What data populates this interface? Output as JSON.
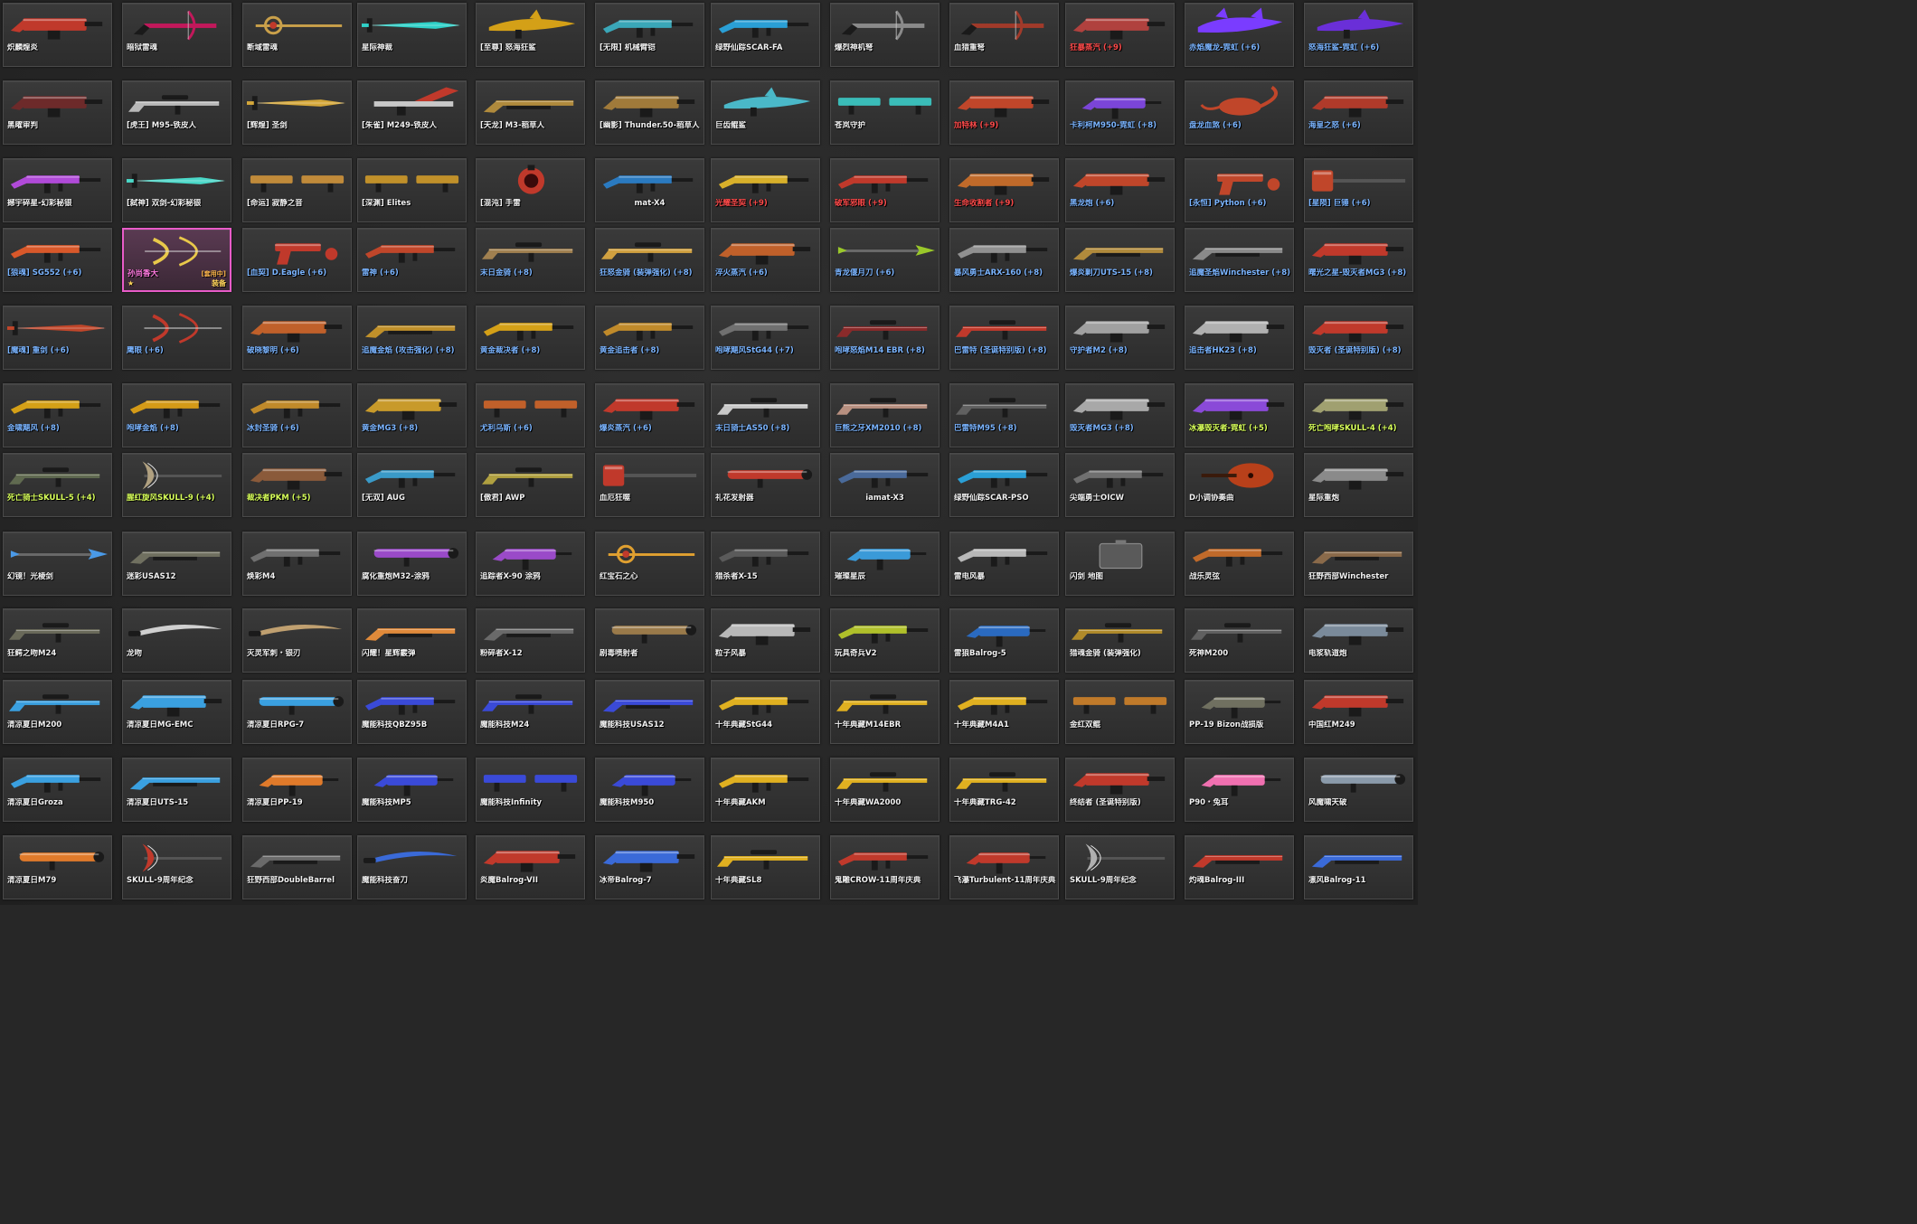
{
  "palette": {
    "name_white": "#f2f2f2",
    "name_red": "#ff4a4a",
    "name_blue": "#7ab4ff",
    "name_green": "#d8ff5a",
    "name_pink": "#ff7ae0",
    "selected_border": "#e85cc8"
  },
  "weapons": [
    {
      "name": "炽麟煌炎",
      "color": "white",
      "icon": "heavy-gun-icon",
      "tint": "#c0392b"
    },
    {
      "name": "暗狱雷魂",
      "color": "white",
      "icon": "crossbow-icon",
      "tint": "#c2185b"
    },
    {
      "name": "断域雷魂",
      "color": "white",
      "icon": "staff-icon",
      "tint": "#c9a04a"
    },
    {
      "name": "星际神裁",
      "color": "white",
      "icon": "sword-icon",
      "tint": "#2fd1c8"
    },
    {
      "name": "[至尊] 怒海狂鲨",
      "color": "white",
      "icon": "shark-gun-icon",
      "tint": "#d4a017"
    },
    {
      "name": "[无限] 机械臂铠",
      "color": "white",
      "icon": "rifle-icon",
      "tint": "#3aa7b8"
    },
    {
      "name": "绿野仙踪SCAR-FA",
      "color": "white",
      "icon": "rifle-icon",
      "tint": "#2a9fd6"
    },
    {
      "name": "爆烈神机弩",
      "color": "white",
      "icon": "crossbow-icon",
      "tint": "#8a8a8a"
    },
    {
      "name": "血猎重弩",
      "color": "white",
      "icon": "crossbow-icon",
      "tint": "#a13a2a"
    },
    {
      "name": "狂暴蒸汽 (+9)",
      "color": "red",
      "icon": "heavy-gun-icon",
      "tint": "#b0413e"
    },
    {
      "name": "赤焰魔龙-霓虹 (+6)",
      "color": "blue",
      "icon": "dragon-gun-icon",
      "tint": "#7a3cff"
    },
    {
      "name": "怒海狂鲨-霓虹 (+6)",
      "color": "blue",
      "icon": "shark-gun-icon",
      "tint": "#6a2fd8"
    },
    {
      "name": "黑曜审判",
      "color": "white",
      "icon": "heavy-gun-icon",
      "tint": "#6d2a2a"
    },
    {
      "name": "[虎王] M95-铁皮人",
      "color": "white",
      "icon": "sniper-icon",
      "tint": "#b8b8b8"
    },
    {
      "name": "[辉煌] 圣剑",
      "color": "white",
      "icon": "sword-icon",
      "tint": "#d4a73a"
    },
    {
      "name": "[朱雀] M249-铁皮人",
      "color": "white",
      "icon": "wing-gun-icon",
      "tint": "#c8c8c8"
    },
    {
      "name": "[天龙] M3-稻草人",
      "color": "white",
      "icon": "shotgun-icon",
      "tint": "#b08a3c"
    },
    {
      "name": "[幽影] Thunder.50-稻草人",
      "color": "white",
      "icon": "heavy-gun-icon",
      "tint": "#a07a3a"
    },
    {
      "name": "巨齿鲲鲨",
      "color": "white",
      "icon": "shark-gun-icon",
      "tint": "#4ab8c8"
    },
    {
      "name": "苍岚守护",
      "color": "white",
      "icon": "dual-icon",
      "tint": "#3abcb8"
    },
    {
      "name": "加特林 (+9)",
      "color": "red",
      "icon": "heavy-gun-icon",
      "tint": "#c0462a"
    },
    {
      "name": "卡利柯M950-霓虹 (+8)",
      "color": "blue",
      "icon": "smg-icon",
      "tint": "#7b45d8"
    },
    {
      "name": "盘龙血煞 (+6)",
      "color": "blue",
      "icon": "scorpion-icon",
      "tint": "#c0462a"
    },
    {
      "name": "海皇之怒 (+6)",
      "color": "blue",
      "icon": "heavy-gun-icon",
      "tint": "#b03a2a"
    },
    {
      "name": "撼宇碎星-幻彩秘银",
      "color": "white",
      "icon": "rifle-icon",
      "tint": "#b04ad8"
    },
    {
      "name": "[弑神] 双剑-幻彩秘银",
      "color": "white",
      "icon": "sword-icon",
      "tint": "#4ad8c8"
    },
    {
      "name": "[命运] 寂静之音",
      "color": "white",
      "icon": "dual-icon",
      "tint": "#c08a3a"
    },
    {
      "name": "[深渊] Elites",
      "color": "white",
      "icon": "dual-icon",
      "tint": "#c0902a"
    },
    {
      "name": "[混沌] 手雷",
      "color": "white",
      "icon": "grenade-icon",
      "tint": "#c0392b"
    },
    {
      "name": "mat-X4",
      "color": "white",
      "icon": "rifle-icon",
      "tint": "#2a7ac0",
      "center": true
    },
    {
      "name": "光耀圣契 (+9)",
      "color": "red",
      "icon": "rifle-icon",
      "tint": "#d8b02a"
    },
    {
      "name": "破军邪眼 (+9)",
      "color": "red",
      "icon": "rifle-icon",
      "tint": "#c0392b"
    },
    {
      "name": "生命收割者 (+9)",
      "color": "red",
      "icon": "heavy-gun-icon",
      "tint": "#c06a2a"
    },
    {
      "name": "黑龙炮 (+6)",
      "color": "blue",
      "icon": "heavy-gun-icon",
      "tint": "#c0462a"
    },
    {
      "name": "[永恒] Python (+6)",
      "color": "blue",
      "icon": "pistol-icon",
      "tint": "#c0462a"
    },
    {
      "name": "[星陨] 巨锤 (+6)",
      "color": "blue",
      "icon": "hammer-icon",
      "tint": "#c0462a"
    },
    {
      "name": "[狼魂] SG552 (+6)",
      "color": "blue",
      "icon": "rifle-icon",
      "tint": "#d8582a"
    },
    {
      "name": "孙尚香大",
      "color": "pink",
      "icon": "bow-icon",
      "tint": "#e8c84a",
      "selected": true,
      "extra": "[套用中]",
      "equip": "装备"
    },
    {
      "name": "[血契] D.Eagle (+6)",
      "color": "blue",
      "icon": "pistol-icon",
      "tint": "#c0392b"
    },
    {
      "name": "雷神 (+6)",
      "color": "blue",
      "icon": "rifle-icon",
      "tint": "#c0462a"
    },
    {
      "name": "末日金骑 (+8)",
      "color": "blue",
      "icon": "sniper-icon",
      "tint": "#a08050"
    },
    {
      "name": "狂怒金骑 (装弹强化) (+8)",
      "color": "blue",
      "icon": "sniper-icon",
      "tint": "#d0a040"
    },
    {
      "name": "淬火蒸汽 (+6)",
      "color": "blue",
      "icon": "heavy-gun-icon",
      "tint": "#c0602a"
    },
    {
      "name": "青龙偃月刀 (+6)",
      "color": "blue",
      "icon": "spear-icon",
      "tint": "#9ac82a"
    },
    {
      "name": "暴风勇士ARX-160 (+8)",
      "color": "blue",
      "icon": "rifle-icon",
      "tint": "#909090"
    },
    {
      "name": "爆炎剿刀UTS-15 (+8)",
      "color": "blue",
      "icon": "shotgun-icon",
      "tint": "#b08a3c"
    },
    {
      "name": "追魔圣焰Winchester (+8)",
      "color": "blue",
      "icon": "shotgun-icon",
      "tint": "#8a8a8a"
    },
    {
      "name": "曙光之星-毁灭者MG3 (+8)",
      "color": "blue",
      "icon": "heavy-gun-icon",
      "tint": "#c0392b"
    },
    {
      "name": "[魔魂] 重剑 (+6)",
      "color": "blue",
      "icon": "sword-icon",
      "tint": "#c0462a"
    },
    {
      "name": "鹰眼 (+6)",
      "color": "blue",
      "icon": "bow-icon",
      "tint": "#c0392b"
    },
    {
      "name": "破晓黎明 (+6)",
      "color": "blue",
      "icon": "heavy-gun-icon",
      "tint": "#c0602a"
    },
    {
      "name": "追魔金焰 (攻击强化) (+8)",
      "color": "blue",
      "icon": "shotgun-icon",
      "tint": "#c0902a"
    },
    {
      "name": "黄金裁决者 (+8)",
      "color": "blue",
      "icon": "rifle-icon",
      "tint": "#d4a017"
    },
    {
      "name": "黄金追击者 (+8)",
      "color": "blue",
      "icon": "rifle-icon",
      "tint": "#c08a2a"
    },
    {
      "name": "咆哮飓风StG44 (+7)",
      "color": "blue",
      "icon": "rifle-icon",
      "tint": "#707070"
    },
    {
      "name": "咆哮怒焰M14 EBR (+8)",
      "color": "blue",
      "icon": "sniper-icon",
      "tint": "#8a2a2a"
    },
    {
      "name": "巴雷特 (圣诞特别版) (+8)",
      "color": "blue",
      "icon": "sniper-icon",
      "tint": "#c0392b"
    },
    {
      "name": "守护者M2 (+8)",
      "color": "blue",
      "icon": "heavy-gun-icon",
      "tint": "#a0a0a0"
    },
    {
      "name": "追击者HK23 (+8)",
      "color": "blue",
      "icon": "heavy-gun-icon",
      "tint": "#b0b0b0"
    },
    {
      "name": "毁灭者 (圣诞特别版) (+8)",
      "color": "blue",
      "icon": "heavy-gun-icon",
      "tint": "#c0392b"
    },
    {
      "name": "金啸飓风 (+8)",
      "color": "blue",
      "icon": "rifle-icon",
      "tint": "#d4a017"
    },
    {
      "name": "咆哮金焰 (+8)",
      "color": "blue",
      "icon": "rifle-icon",
      "tint": "#d49a17"
    },
    {
      "name": "冰封圣骑 (+6)",
      "color": "blue",
      "icon": "rifle-icon",
      "tint": "#c08a2a"
    },
    {
      "name": "黄金MG3 (+8)",
      "color": "blue",
      "icon": "heavy-gun-icon",
      "tint": "#c89a2a"
    },
    {
      "name": "尤利乌斯 (+6)",
      "color": "blue",
      "icon": "dual-icon",
      "tint": "#c0602a"
    },
    {
      "name": "爆炎蒸汽 (+6)",
      "color": "blue",
      "icon": "heavy-gun-icon",
      "tint": "#c0392b"
    },
    {
      "name": "末日骑士AS50 (+8)",
      "color": "blue",
      "icon": "sniper-icon",
      "tint": "#c8c8c8"
    },
    {
      "name": "巨熊之牙XM2010 (+8)",
      "color": "blue",
      "icon": "sniper-icon",
      "tint": "#b89080"
    },
    {
      "name": "巴雷特M95 (+8)",
      "color": "blue",
      "icon": "sniper-icon",
      "tint": "#606060"
    },
    {
      "name": "毁灭者MG3 (+8)",
      "color": "blue",
      "icon": "heavy-gun-icon",
      "tint": "#a8a8a8"
    },
    {
      "name": "冰瀑毁灭者-霓虹 (+5)",
      "color": "green",
      "icon": "heavy-gun-icon",
      "tint": "#8a4ad8"
    },
    {
      "name": "死亡咆哮SKULL-4 (+4)",
      "color": "green",
      "icon": "heavy-gun-icon",
      "tint": "#a0a070"
    },
    {
      "name": "死亡骑士SKULL-5 (+4)",
      "color": "green",
      "icon": "sniper-icon",
      "tint": "#606a50"
    },
    {
      "name": "腥红旋风SKULL-9 (+4)",
      "color": "green",
      "icon": "axe-icon",
      "tint": "#b0a080"
    },
    {
      "name": "裁决者PKM (+5)",
      "color": "green",
      "icon": "heavy-gun-icon",
      "tint": "#8a5a3a"
    },
    {
      "name": "[无双] AUG",
      "color": "white",
      "icon": "rifle-icon",
      "tint": "#3a9ac8"
    },
    {
      "name": "[傲君] AWP",
      "color": "white",
      "icon": "sniper-icon",
      "tint": "#b0a040"
    },
    {
      "name": "血厄狂噬",
      "color": "white",
      "icon": "hammer-icon",
      "tint": "#c0392b"
    },
    {
      "name": "礼花发射器",
      "color": "white",
      "icon": "launcher-icon",
      "tint": "#c0392b"
    },
    {
      "name": "iamat-X3",
      "color": "white",
      "icon": "rifle-icon",
      "tint": "#4a6a9a",
      "center": true
    },
    {
      "name": "绿野仙踪SCAR-PSO",
      "color": "white",
      "icon": "rifle-icon",
      "tint": "#2a9fd6"
    },
    {
      "name": "尖端勇士OICW",
      "color": "white",
      "icon": "rifle-icon",
      "tint": "#707070"
    },
    {
      "name": "D小调协奏曲",
      "color": "white",
      "icon": "violin-icon",
      "tint": "#b8401a"
    },
    {
      "name": "星际重炮",
      "color": "white",
      "icon": "heavy-gun-icon",
      "tint": "#8a8a8a"
    },
    {
      "name": "幻镜！光棱剑",
      "color": "white",
      "icon": "spear-icon",
      "tint": "#4a9ae8"
    },
    {
      "name": "迷彩USAS12",
      "color": "white",
      "icon": "shotgun-icon",
      "tint": "#707060"
    },
    {
      "name": "焕彩M4",
      "color": "white",
      "icon": "rifle-icon",
      "tint": "#707070"
    },
    {
      "name": "腐化重炮M32-涂鸦",
      "color": "white",
      "icon": "launcher-icon",
      "tint": "#9a4ac8"
    },
    {
      "name": "追踪者X-90 涂鸦",
      "color": "white",
      "icon": "smg-icon",
      "tint": "#9a4ac8"
    },
    {
      "name": "红宝石之心",
      "color": "white",
      "icon": "staff-icon",
      "tint": "#e0a030"
    },
    {
      "name": "猎杀者X-15",
      "color": "white",
      "icon": "rifle-icon",
      "tint": "#5a5a5a"
    },
    {
      "name": "璀璨星辰",
      "color": "white",
      "icon": "smg-icon",
      "tint": "#3a9ad8"
    },
    {
      "name": "雷电风暴",
      "color": "white",
      "icon": "rifle-icon",
      "tint": "#b8b8b8"
    },
    {
      "name": "闪剑 地图",
      "color": "white",
      "icon": "case-icon",
      "tint": "#888888"
    },
    {
      "name": "战乐灵弦",
      "color": "white",
      "icon": "rifle-icon",
      "tint": "#c06a2a"
    },
    {
      "name": "狂野西部Winchester",
      "color": "white",
      "icon": "shotgun-icon",
      "tint": "#8a6a4a"
    },
    {
      "name": "狂鳄之吻M24",
      "color": "white",
      "icon": "sniper-icon",
      "tint": "#6a6a5a"
    },
    {
      "name": "龙吻",
      "color": "white",
      "icon": "blade-icon",
      "tint": "#d0d0d0"
    },
    {
      "name": "灭灵军刺・银刃",
      "color": "white",
      "icon": "blade-icon",
      "tint": "#c0a070"
    },
    {
      "name": "闪耀！星辉霰弹",
      "color": "white",
      "icon": "shotgun-icon",
      "tint": "#e08a3a"
    },
    {
      "name": "粉碎者X-12",
      "color": "white",
      "icon": "shotgun-icon",
      "tint": "#6a6a6a"
    },
    {
      "name": "剧毒喷射者",
      "color": "white",
      "icon": "launcher-icon",
      "tint": "#9a7a4a"
    },
    {
      "name": "粒子风暴",
      "color": "white",
      "icon": "heavy-gun-icon",
      "tint": "#b8b8b8"
    },
    {
      "name": "玩具奇兵V2",
      "color": "white",
      "icon": "rifle-icon",
      "tint": "#b0c02a"
    },
    {
      "name": "雷狼Balrog-5",
      "color": "white",
      "icon": "smg-icon",
      "tint": "#2a6ac0"
    },
    {
      "name": "猎魂金骑 (装弹强化)",
      "color": "white",
      "icon": "sniper-icon",
      "tint": "#b08a2a"
    },
    {
      "name": "死神M200",
      "color": "white",
      "icon": "sniper-icon",
      "tint": "#606060"
    },
    {
      "name": "电浆轨道炮",
      "color": "white",
      "icon": "heavy-gun-icon",
      "tint": "#7a8a9a"
    },
    {
      "name": "清凉夏日M200",
      "color": "white",
      "icon": "sniper-icon",
      "tint": "#3aa0e0"
    },
    {
      "name": "清凉夏日MG-EMC",
      "color": "white",
      "icon": "heavy-gun-icon",
      "tint": "#3aa0e0"
    },
    {
      "name": "清凉夏日RPG-7",
      "color": "white",
      "icon": "launcher-icon",
      "tint": "#3aa0e0"
    },
    {
      "name": "魔能科技QBZ95B",
      "color": "white",
      "icon": "rifle-icon",
      "tint": "#3a4ad8"
    },
    {
      "name": "魔能科技M24",
      "color": "white",
      "icon": "sniper-icon",
      "tint": "#3a4ad8"
    },
    {
      "name": "魔能科技USAS12",
      "color": "white",
      "icon": "shotgun-icon",
      "tint": "#3a4ad8"
    },
    {
      "name": "十年典藏StG44",
      "color": "white",
      "icon": "rifle-icon",
      "tint": "#e0b020"
    },
    {
      "name": "十年典藏M14EBR",
      "color": "white",
      "icon": "sniper-icon",
      "tint": "#e0b020"
    },
    {
      "name": "十年典藏M4A1",
      "color": "white",
      "icon": "rifle-icon",
      "tint": "#e0b020"
    },
    {
      "name": "金红双鲲",
      "color": "white",
      "icon": "dual-icon",
      "tint": "#c07a2a"
    },
    {
      "name": "PP-19 Bizon战损版",
      "color": "white",
      "icon": "smg-icon",
      "tint": "#707060"
    },
    {
      "name": "中国红M249",
      "color": "white",
      "icon": "heavy-gun-icon",
      "tint": "#c0392b"
    },
    {
      "name": "清凉夏日Groza",
      "color": "white",
      "icon": "rifle-icon",
      "tint": "#3aa0e0"
    },
    {
      "name": "清凉夏日UTS-15",
      "color": "white",
      "icon": "shotgun-icon",
      "tint": "#3aa0e0"
    },
    {
      "name": "清凉夏日PP-19",
      "color": "white",
      "icon": "smg-icon",
      "tint": "#e07a2a"
    },
    {
      "name": "魔能科技MP5",
      "color": "white",
      "icon": "smg-icon",
      "tint": "#3a4ad8"
    },
    {
      "name": "魔能科技Infinity",
      "color": "white",
      "icon": "dual-icon",
      "tint": "#3a4ad8"
    },
    {
      "name": "魔能科技M950",
      "color": "white",
      "icon": "smg-icon",
      "tint": "#3a4ad8"
    },
    {
      "name": "十年典藏AKM",
      "color": "white",
      "icon": "rifle-icon",
      "tint": "#e0b020"
    },
    {
      "name": "十年典藏WA2000",
      "color": "white",
      "icon": "sniper-icon",
      "tint": "#e0b020"
    },
    {
      "name": "十年典藏TRG-42",
      "color": "white",
      "icon": "sniper-icon",
      "tint": "#e0b020"
    },
    {
      "name": "终结者 (圣诞特别版)",
      "color": "white",
      "icon": "heavy-gun-icon",
      "tint": "#c0392b"
    },
    {
      "name": "P90・兔耳",
      "color": "white",
      "icon": "smg-icon",
      "tint": "#f070b0"
    },
    {
      "name": "风魔啸天破",
      "color": "white",
      "icon": "launcher-icon",
      "tint": "#8a9aaa"
    },
    {
      "name": "清凉夏日M79",
      "color": "white",
      "icon": "launcher-icon",
      "tint": "#e07a2a"
    },
    {
      "name": "SKULL-9周年纪念",
      "color": "white",
      "icon": "axe-icon",
      "tint": "#c0392b"
    },
    {
      "name": "狂野西部DoubleBarrel",
      "color": "white",
      "icon": "shotgun-icon",
      "tint": "#6a6a6a"
    },
    {
      "name": "魔能科技奋刀",
      "color": "white",
      "icon": "blade-icon",
      "tint": "#3a6ad8"
    },
    {
      "name": "炎魔Balrog-VII",
      "color": "white",
      "icon": "heavy-gun-icon",
      "tint": "#c0392b"
    },
    {
      "name": "冰帝Balrog-7",
      "color": "white",
      "icon": "heavy-gun-icon",
      "tint": "#3a6ad8"
    },
    {
      "name": "十年典藏SL8",
      "color": "white",
      "icon": "sniper-icon",
      "tint": "#e0b020"
    },
    {
      "name": "鬼雕CROW-11周年庆典",
      "color": "white",
      "icon": "rifle-icon",
      "tint": "#c0392b"
    },
    {
      "name": "飞瀑Turbulent-11周年庆典",
      "color": "white",
      "icon": "smg-icon",
      "tint": "#c0392b"
    },
    {
      "name": "SKULL-9周年纪念",
      "color": "white",
      "icon": "axe-icon",
      "tint": "#b0b0b0"
    },
    {
      "name": "灼魂Balrog-III",
      "color": "white",
      "icon": "shotgun-icon",
      "tint": "#c0392b"
    },
    {
      "name": "凛风Balrog-11",
      "color": "white",
      "icon": "shotgun-icon",
      "tint": "#3a6ad8"
    }
  ]
}
